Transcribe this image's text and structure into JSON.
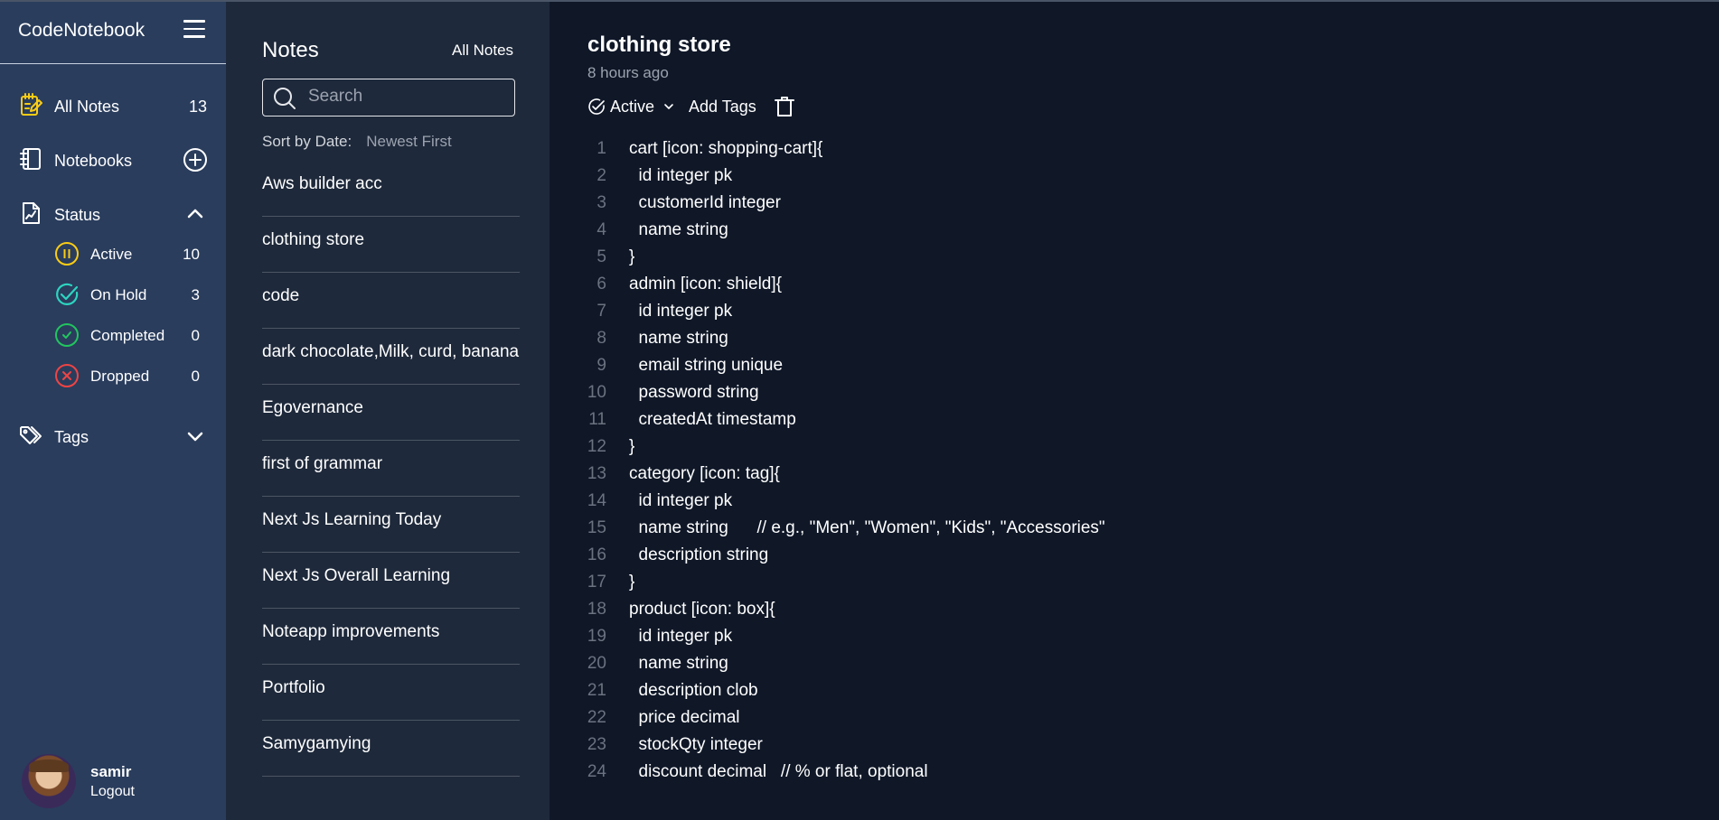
{
  "app": {
    "title": "CodeNotebook"
  },
  "sidebar": {
    "all_notes": {
      "label": "All Notes",
      "count": "13"
    },
    "notebooks": {
      "label": "Notebooks"
    },
    "status": {
      "label": "Status",
      "items": [
        {
          "label": "Active",
          "count": "10",
          "color": "#facc15"
        },
        {
          "label": "On Hold",
          "count": "3",
          "color": "#2dd4bf"
        },
        {
          "label": "Completed",
          "count": "0",
          "color": "#22c55e"
        },
        {
          "label": "Dropped",
          "count": "0",
          "color": "#ef4444"
        }
      ]
    },
    "tags": {
      "label": "Tags"
    },
    "user": {
      "name": "samir",
      "logout": "Logout"
    }
  },
  "notes_panel": {
    "title": "Notes",
    "filter_link": "All Notes",
    "search_placeholder": "Search",
    "sort_label": "Sort by Date:",
    "sort_value": "Newest First",
    "notes": [
      "Aws builder acc",
      "clothing store",
      "code",
      "dark chocolate,Milk, curd, banana",
      "Egovernance",
      "first of grammar",
      "Next Js Learning Today",
      "Next Js Overall Learning",
      "Noteapp improvements",
      "Portfolio",
      "Samygamying"
    ]
  },
  "editor": {
    "title": "clothing store",
    "timestamp": "8 hours ago",
    "status_label": "Active",
    "add_tags_label": "Add Tags",
    "lines": [
      {
        "n": "1",
        "text": "cart [icon: shopping-cart]{"
      },
      {
        "n": "2",
        "text": "  id integer pk"
      },
      {
        "n": "3",
        "text": "  customerId integer"
      },
      {
        "n": "4",
        "text": "  name string"
      },
      {
        "n": "5",
        "text": "}"
      },
      {
        "n": "6",
        "text": "admin [icon: shield]{"
      },
      {
        "n": "7",
        "text": "  id integer pk"
      },
      {
        "n": "8",
        "text": "  name string"
      },
      {
        "n": "9",
        "text": "  email string unique"
      },
      {
        "n": "10",
        "text": "  password string"
      },
      {
        "n": "11",
        "text": "  createdAt timestamp"
      },
      {
        "n": "12",
        "text": "}"
      },
      {
        "n": "13",
        "text": "category [icon: tag]{"
      },
      {
        "n": "14",
        "text": "  id integer pk"
      },
      {
        "n": "15",
        "text": "  name string      // e.g., \"Men\", \"Women\", \"Kids\", \"Accessories\""
      },
      {
        "n": "16",
        "text": "  description string"
      },
      {
        "n": "17",
        "text": "}"
      },
      {
        "n": "18",
        "text": "product [icon: box]{"
      },
      {
        "n": "19",
        "text": "  id integer pk"
      },
      {
        "n": "20",
        "text": "  name string"
      },
      {
        "n": "21",
        "text": "  description clob"
      },
      {
        "n": "22",
        "text": "  price decimal"
      },
      {
        "n": "23",
        "text": "  stockQty integer"
      },
      {
        "n": "24",
        "text": "  discount decimal   // % or flat, optional"
      }
    ]
  }
}
